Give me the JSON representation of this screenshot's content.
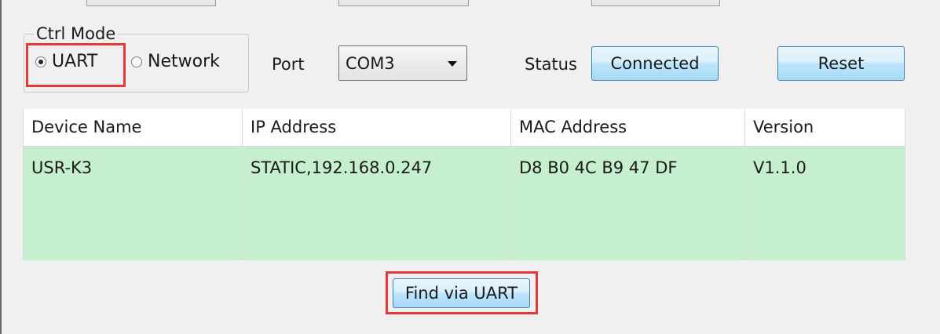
{
  "ctrl_mode": {
    "legend": "Ctrl Mode",
    "options": [
      {
        "label": "UART",
        "selected": true
      },
      {
        "label": "Network",
        "selected": false
      }
    ]
  },
  "port": {
    "label": "Port",
    "value": "COM3"
  },
  "status": {
    "label": "Status",
    "value": "Connected"
  },
  "reset_label": "Reset",
  "table": {
    "headers": [
      "Device Name",
      "IP Address",
      "MAC Address",
      "Version"
    ],
    "rows": [
      [
        "USR-K3",
        "STATIC,192.168.0.247",
        "D8 B0 4C B9 47 DF",
        "V1.1.0"
      ]
    ]
  },
  "find_label": "Find via UART",
  "colors": {
    "row_highlight": "#c6efce",
    "annotation_box": "#e53935",
    "button_face": "#bee6fd"
  }
}
